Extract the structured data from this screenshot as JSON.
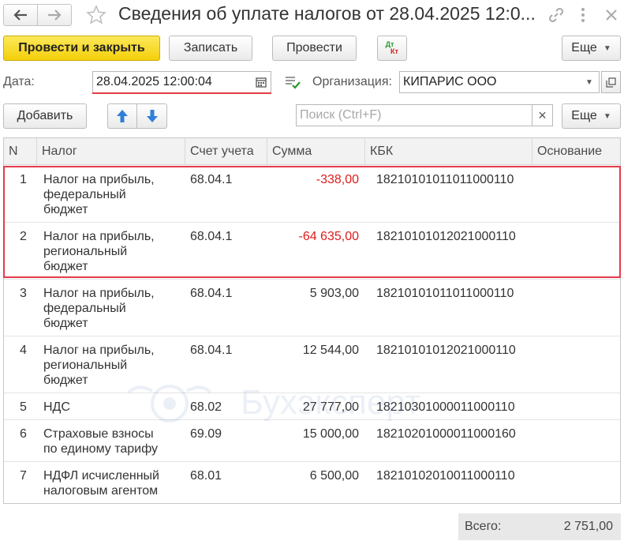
{
  "window": {
    "title": "Сведения об уплате налогов от 28.04.2025 12:0...",
    "icons": [
      "back-arrow",
      "forward-arrow",
      "favorite-star",
      "link-chain",
      "more-vertical",
      "close-x"
    ]
  },
  "toolbar": {
    "post_close_label": "Провести и закрыть",
    "save_label": "Записать",
    "post_label": "Провести",
    "dt_kt_top": "Дт",
    "dt_kt_bottom": "Кт",
    "more_label": "Еще"
  },
  "form": {
    "date_label": "Дата:",
    "date_value": "28.04.2025 12:00:04",
    "org_label": "Организация:",
    "org_value": "КИПАРИС ООО"
  },
  "table_toolbar": {
    "add_label": "Добавить",
    "search_placeholder": "Поиск (Ctrl+F)",
    "clear_symbol": "×",
    "more_label": "Еще"
  },
  "table": {
    "columns": [
      "N",
      "Налог",
      "Счет учета",
      "Сумма",
      "КБК",
      "Основание"
    ],
    "rows": [
      {
        "n": "1",
        "tax": [
          "Налог на прибыль,",
          "федеральный",
          "бюджет"
        ],
        "account": "68.04.1",
        "sum": "-338,00",
        "kbk": "18210101011011000110",
        "basis": "",
        "negative": true
      },
      {
        "n": "2",
        "tax": [
          "Налог на прибыль,",
          "региональный",
          "бюджет"
        ],
        "account": "68.04.1",
        "sum": "-64 635,00",
        "kbk": "18210101012021000110",
        "basis": "",
        "negative": true
      },
      {
        "n": "3",
        "tax": [
          "Налог на прибыль,",
          "федеральный",
          "бюджет"
        ],
        "account": "68.04.1",
        "sum": "5 903,00",
        "kbk": "18210101011011000110",
        "basis": "",
        "negative": false
      },
      {
        "n": "4",
        "tax": [
          "Налог на прибыль,",
          "региональный",
          "бюджет"
        ],
        "account": "68.04.1",
        "sum": "12 544,00",
        "kbk": "18210101012021000110",
        "basis": "",
        "negative": false
      },
      {
        "n": "5",
        "tax": [
          "НДС"
        ],
        "account": "68.02",
        "sum": "27 777,00",
        "kbk": "18210301000011000110",
        "basis": "",
        "negative": false
      },
      {
        "n": "6",
        "tax": [
          "Страховые взносы",
          "по единому тарифу"
        ],
        "account": "69.09",
        "sum": "15 000,00",
        "kbk": "18210201000011000160",
        "basis": "",
        "negative": false
      },
      {
        "n": "7",
        "tax": [
          "НДФЛ исчисленный",
          "налоговым агентом"
        ],
        "account": "68.01",
        "sum": "6 500,00",
        "kbk": "18210102010011000110",
        "basis": "",
        "negative": false
      }
    ]
  },
  "watermark": {
    "text": "Бухэксперт"
  },
  "footer": {
    "total_label": "Всего:",
    "total_value": "2 751,00"
  },
  "colors": {
    "primary_button": "#f5d30f",
    "negative": "#e01b1b",
    "highlight": "#e53b4a",
    "blue_arrow": "#2f7fd8"
  }
}
